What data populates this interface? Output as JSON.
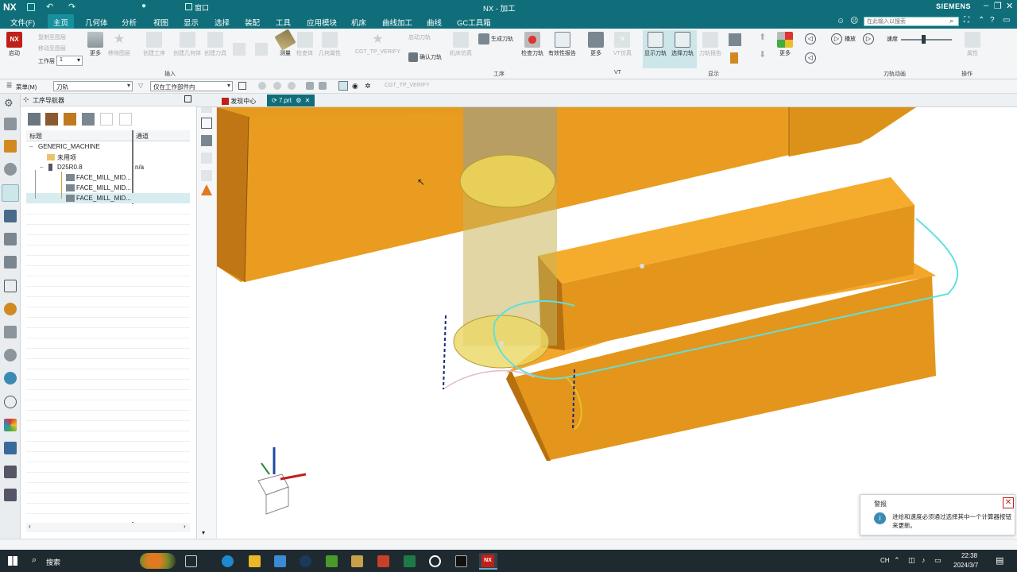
{
  "titlebar": {
    "app_logo": "NX",
    "window_menu": "窗口",
    "title": "NX - 加工",
    "brand": "SIEMENS"
  },
  "menu": {
    "items": [
      "文件(F)",
      "主页",
      "几何体",
      "分析",
      "视图",
      "显示",
      "选择",
      "装配",
      "工具",
      "应用模块",
      "机床",
      "曲线加工",
      "曲线",
      "GC工具箱"
    ],
    "active": "主页",
    "search_placeholder": "在此输入以搜索"
  },
  "ribbon": {
    "launch": "启动",
    "layer_label": "工作层",
    "layer_value": "1",
    "more": "更多",
    "copy_face": "复制至图层",
    "move_face": "移动至图层",
    "delete": "移除图层",
    "create_op": "创建工序",
    "create_geo": "创建几何体",
    "create_tool": "创建刀具",
    "measure": "测量",
    "stock": "检查体",
    "geo_attr": "几何属性",
    "cgt_verify": "CGT_TP_VERIFY",
    "regen": "启动刀轨",
    "confirm_path": "确认刀轨",
    "sim": "机床仿真",
    "gen_path": "生成刀轨",
    "check_tool": "检查刀轨",
    "validity_report": "有效性报告",
    "more2": "更多",
    "vt_sim": "VT仿真",
    "show_path": "显示刀轨",
    "select_path": "选择刀轨",
    "path_report": "刀轨报告",
    "more3": "更多",
    "play": "播放",
    "speed": "速度",
    "attr": "属性",
    "groups": {
      "insert": "插入",
      "operation": "工序",
      "vt": "VT",
      "display": "显示",
      "animation": "刀轨动画",
      "ops": "操作"
    }
  },
  "toolbar2": {
    "menu": "菜单(M)",
    "filter": "刀轨",
    "scope": "仅在工作部件内",
    "cgt": "CGT_TP_VERIFY"
  },
  "navigator": {
    "title": "工序导航器",
    "col_name": "标题",
    "col_channel": "通道",
    "rows": [
      {
        "name": "GENERIC_MACHINE",
        "channel": ""
      },
      {
        "name": "未用项",
        "channel": ""
      },
      {
        "name": "D25R0.8",
        "channel": "n/a"
      },
      {
        "name": "FACE_MILL_MID...",
        "channel": ""
      },
      {
        "name": "FACE_MILL_MID...",
        "channel": ""
      },
      {
        "name": "FACE_MILL_MID...",
        "channel": ""
      }
    ]
  },
  "tabs": {
    "discover": "发现中心",
    "file": "7.prt"
  },
  "alert": {
    "title": "警报",
    "message": "进给和速度必须通过选择其中一个计算器按钮来更新。"
  },
  "taskbar": {
    "search": "搜索",
    "ime": "CH",
    "time": "22:38",
    "date": "2024/3/7",
    "nx_label": "NX"
  },
  "colors": {
    "teal": "#0f6e79",
    "part_orange": "#f0a020",
    "toolpath_cyan": "#5fe0e0"
  }
}
